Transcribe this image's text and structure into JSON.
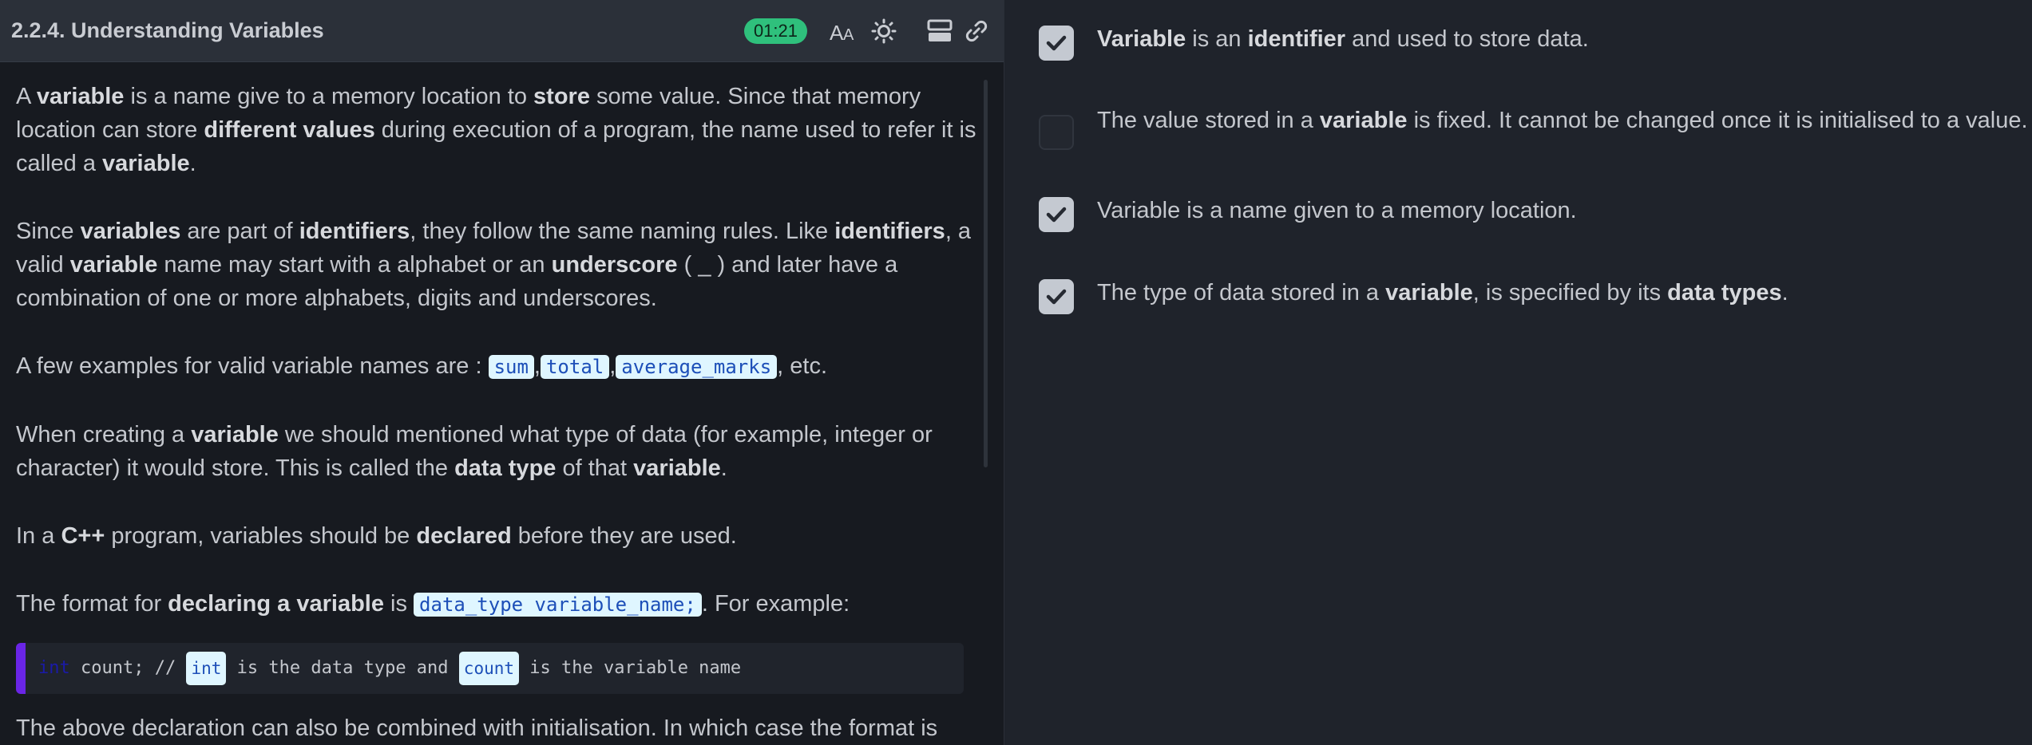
{
  "header": {
    "title": "2.2.4. Understanding Variables",
    "timer": "01:21"
  },
  "icons": [
    "font-size-icon",
    "theme-sun-icon",
    "layout-icon",
    "link-icon"
  ],
  "content": {
    "p1": {
      "a": "A ",
      "b": "variable",
      "c": " is a name give to a memory location to ",
      "d": "store",
      "e": " some value. Since that memory location can store ",
      "f": "different values",
      "g": " during execution of a program, the name used to refer it is called a ",
      "h": "variable",
      "i": "."
    },
    "p2": {
      "a": "Since ",
      "b": "variables",
      "c": " are part of ",
      "d": "identifiers",
      "e": ", they follow the same naming rules. Like ",
      "f": "identifiers",
      "g": ", a valid ",
      "h": "variable",
      "i": " name may start with a alphabet or an ",
      "j": "underscore",
      "k": " ( _ ) and later have a combination of one or more alphabets, digits and underscores."
    },
    "p3": {
      "a": "A few examples for valid variable names are : ",
      "c1": "sum",
      "sep1": ",",
      "c2": "total",
      "sep2": ",",
      "c3": "average_marks",
      "e": ", etc."
    },
    "p4": {
      "a": "When creating a ",
      "b": "variable",
      "c": " we should mentioned what type of data (for example, integer or character) it would store. This is called the ",
      "d": "data type",
      "e": " of that ",
      "f": "variable",
      "g": "."
    },
    "p5": {
      "a": "In a ",
      "b": "C++",
      "c": " program, variables should be ",
      "d": "declared",
      "e": " before they are used."
    },
    "p6": {
      "a": "The format for ",
      "b": "declaring a variable",
      "c": " is ",
      "code": "data_type variable_name;",
      "d": ". For example:"
    },
    "codeblock": {
      "kw": "int",
      "a": " count; // ",
      "chip1": "int",
      "b": " is the data type and ",
      "chip2": "count",
      "c": " is the variable name"
    },
    "p7": {
      "a": "The above declaration can also be combined with initialisation. In which case the format is"
    }
  },
  "options": [
    {
      "checked": true,
      "parts": {
        "a": "Variable",
        "b": " is an ",
        "c": "identifier",
        "d": " and used to store data."
      }
    },
    {
      "checked": false,
      "parts": {
        "a": "The value stored in a ",
        "b": "variable",
        "c": " is fixed. It cannot be changed once it is initialised to a value."
      }
    },
    {
      "checked": true,
      "parts": {
        "a": "Variable is a name given to a memory location."
      }
    },
    {
      "checked": true,
      "parts": {
        "a": "The type of data stored in a ",
        "b": "variable",
        "c": ", is specified by its ",
        "d": "data types",
        "e": "."
      }
    }
  ],
  "colors": {
    "accent_timer": "#2fc07c",
    "code_border": "#6a25e6",
    "chip_bg": "#dff6ff",
    "chip_text": "#1d4fb8"
  }
}
